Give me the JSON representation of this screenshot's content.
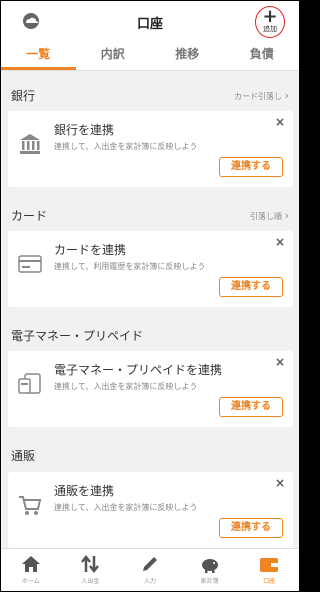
{
  "header": {
    "title": "口座",
    "add_label": "追加",
    "add_symbol": "+"
  },
  "tabs": [
    {
      "label": "一覧",
      "active": true
    },
    {
      "label": "内訳",
      "active": false
    },
    {
      "label": "推移",
      "active": false
    },
    {
      "label": "負債",
      "active": false
    }
  ],
  "sections": [
    {
      "name": "銀行",
      "link": "カード引落し",
      "card": {
        "title": "銀行を連携",
        "desc": "連携して、入出金を家計簿に反映しよう",
        "button": "連携する",
        "icon": "bank-icon"
      }
    },
    {
      "name": "カード",
      "link": "引落し順",
      "card": {
        "title": "カードを連携",
        "desc": "連携して、利用履歴を家計簿に反映しよう",
        "button": "連携する",
        "icon": "credit-card-icon"
      }
    },
    {
      "name": "電子マネー・プリペイド",
      "link": "",
      "card": {
        "title": "電子マネー・プリペイドを連携",
        "desc": "連携して、入出金を家計簿に反映しよう",
        "button": "連携する",
        "icon": "emoney-icon"
      }
    },
    {
      "name": "通販",
      "link": "",
      "card": {
        "title": "通販を連携",
        "desc": "連携して、入出金を家計簿に反映しよう",
        "button": "連携する",
        "icon": "cart-icon"
      }
    }
  ],
  "close_symbol": "×",
  "chevron": "›",
  "bottom_nav": [
    {
      "label": "ホーム",
      "icon": "home-icon",
      "active": false
    },
    {
      "label": "入出金",
      "icon": "transfer-icon",
      "active": false
    },
    {
      "label": "入力",
      "icon": "pencil-icon",
      "active": false
    },
    {
      "label": "家計簿",
      "icon": "piggy-bank-icon",
      "active": false
    },
    {
      "label": "口座",
      "icon": "wallet-icon",
      "active": true
    }
  ],
  "colors": {
    "accent": "#ef8423",
    "add_circle": "#e0201a",
    "icon_gray": "#555555"
  }
}
